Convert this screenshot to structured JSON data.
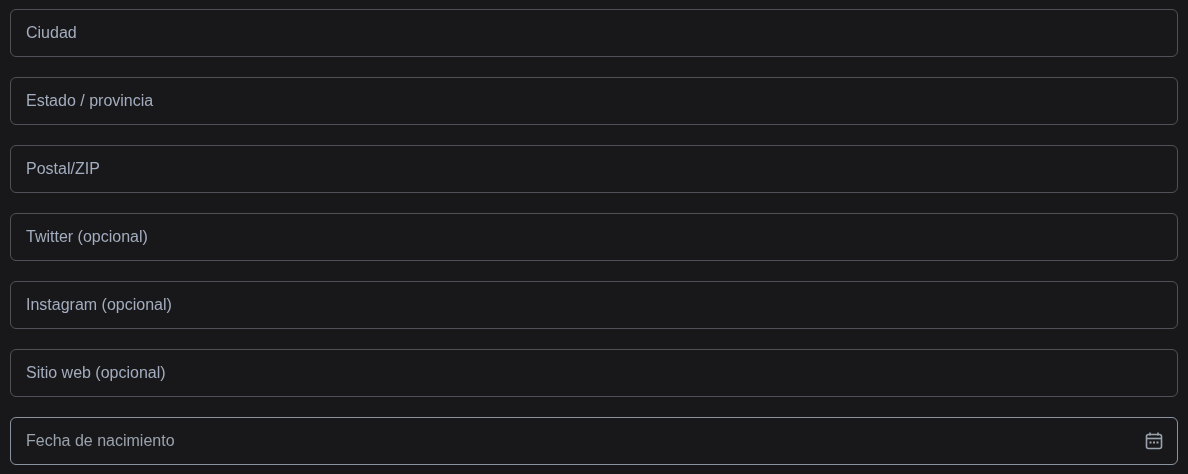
{
  "fields": [
    {
      "kind": "text",
      "placeholder": "Ciudad",
      "highlighted": false
    },
    {
      "kind": "text",
      "placeholder": "Estado / provincia",
      "highlighted": false
    },
    {
      "kind": "text",
      "placeholder": "Postal/ZIP",
      "highlighted": false
    },
    {
      "kind": "text",
      "placeholder": "Twitter (opcional)",
      "highlighted": false
    },
    {
      "kind": "text",
      "placeholder": "Instagram (opcional)",
      "highlighted": false
    },
    {
      "kind": "text",
      "placeholder": "Sitio web (opcional)",
      "highlighted": false
    },
    {
      "kind": "date",
      "placeholder": "Fecha de nacimiento",
      "highlighted": true
    }
  ]
}
